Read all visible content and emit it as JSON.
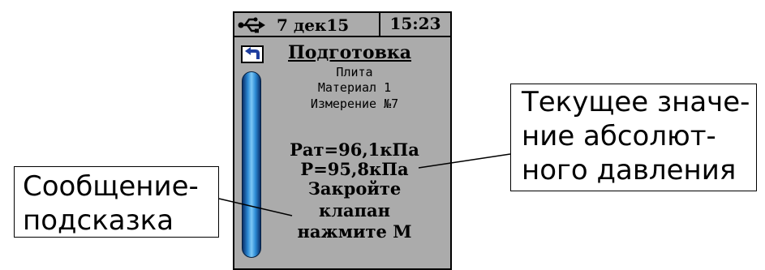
{
  "status_bar": {
    "icon": "usb-icon",
    "date": "7 дек15",
    "time": "15:23"
  },
  "screen": {
    "back_icon": "back-arrow-icon",
    "title": "Подготовка",
    "info": [
      "Плита",
      "Материал 1",
      "Измерение №7"
    ],
    "pressure_atm": "Pат=96,1кПа",
    "pressure": "P=95,8кПа",
    "hint": [
      "Закройте",
      "клапан",
      "нажмите М"
    ]
  },
  "callouts": {
    "left": [
      "Сообщение-",
      "подсказка"
    ],
    "right": [
      "Текущее значе-",
      "ние абсолют-",
      "ного давления"
    ]
  },
  "colors": {
    "screen_bg": "#ababab",
    "scrollbar": "#2d8cd6",
    "back_arrow": "#1f3f9f"
  }
}
